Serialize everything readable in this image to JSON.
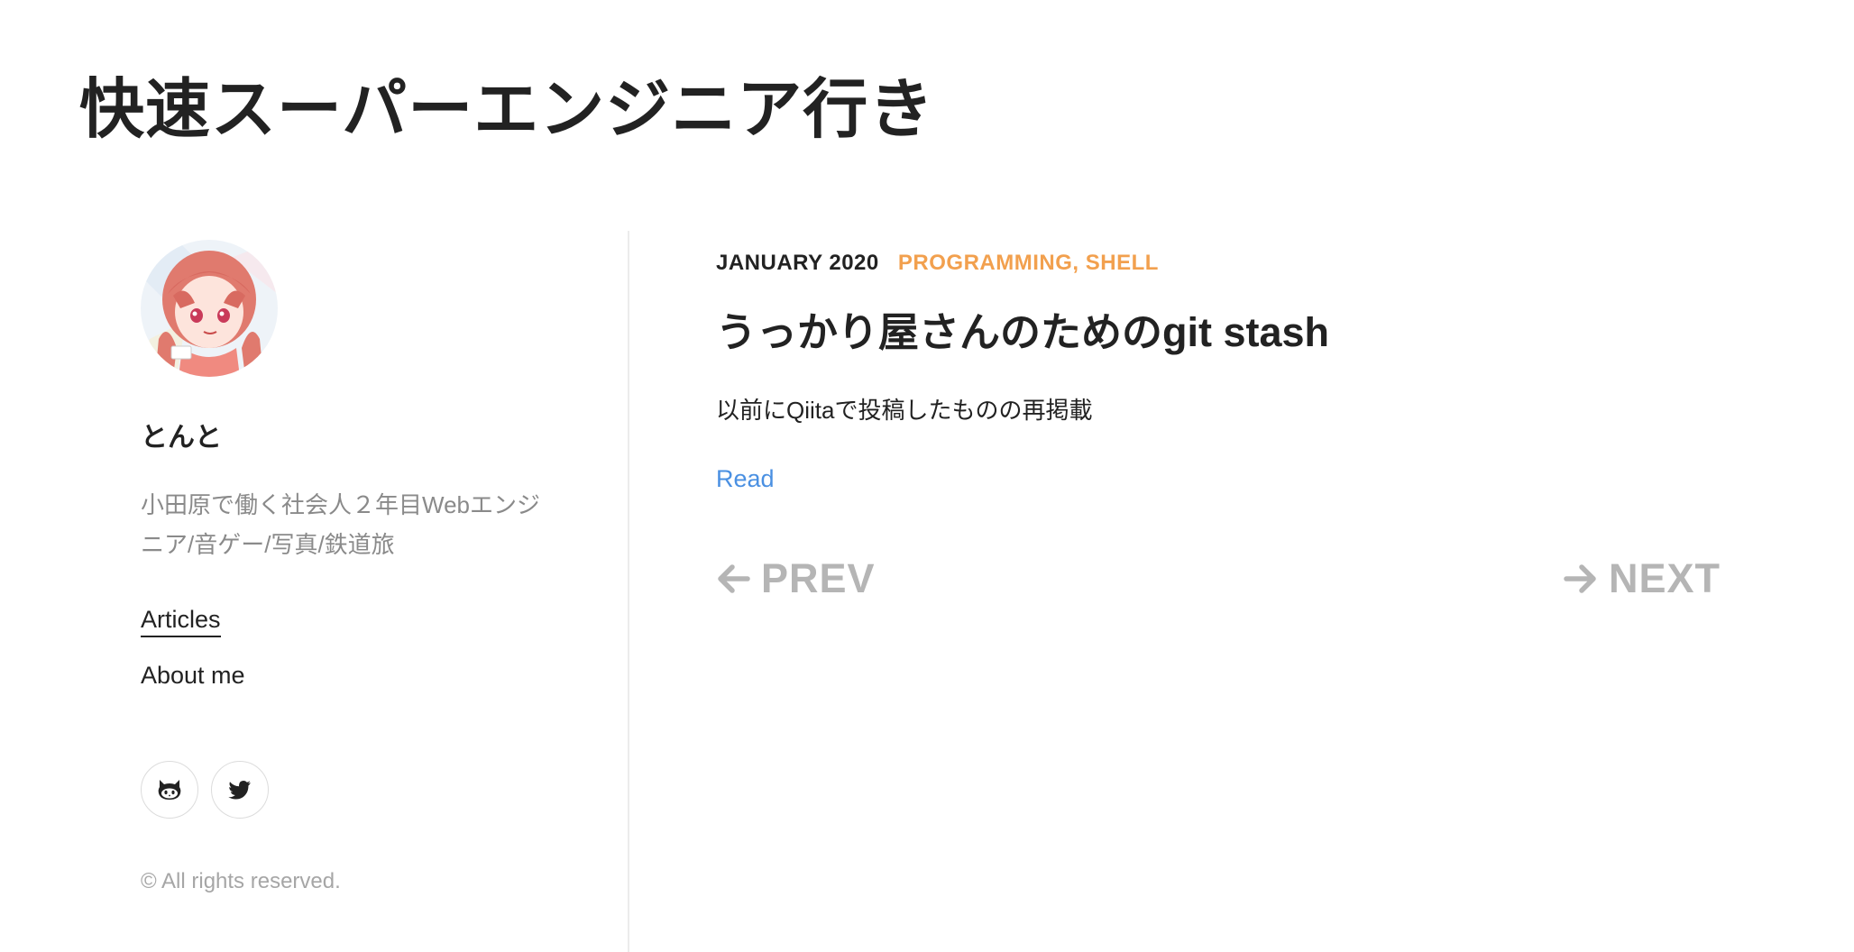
{
  "site": {
    "title": "快速スーパーエンジニア行き"
  },
  "sidebar": {
    "author_name": "とんと",
    "bio": "小田原で働く社会人２年目Webエンジニア/音ゲー/写真/鉄道旅",
    "nav": [
      {
        "label": "Articles",
        "active": true
      },
      {
        "label": "About me",
        "active": false
      }
    ],
    "social": [
      {
        "icon": "github-icon"
      },
      {
        "icon": "twitter-icon"
      }
    ],
    "copyright": "© All rights reserved."
  },
  "post": {
    "date": "JANUARY 2020",
    "categories": "PROGRAMMING, SHELL",
    "title": "うっかり屋さんのためのgit stash",
    "excerpt": "以前にQiitaで投稿したものの再掲載",
    "read_label": "Read"
  },
  "pager": {
    "prev_label": "PREV",
    "next_label": "NEXT"
  },
  "colors": {
    "accent_category": "#f2a04e",
    "link": "#4a90e2",
    "muted": "#b5b5b5"
  }
}
